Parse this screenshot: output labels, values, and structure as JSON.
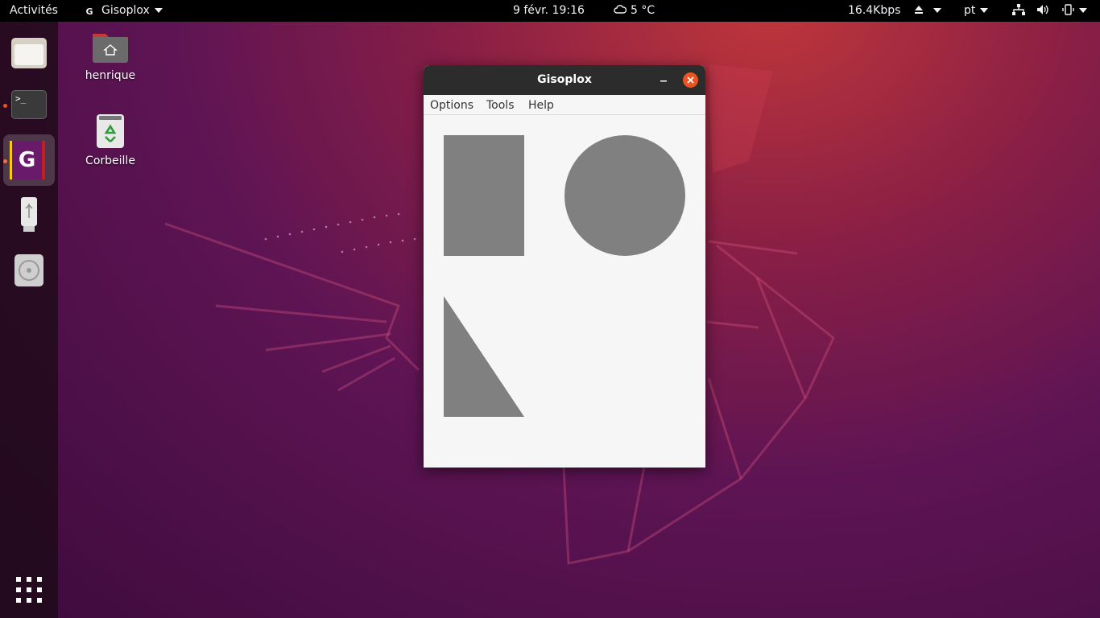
{
  "topbar": {
    "activities": "Activités",
    "app_name": "Gisoplox",
    "app_icon_glyph": "G",
    "datetime": "9 févr.  19:16",
    "weather": "5 °C",
    "network_speed": "16.4Kbps",
    "language": "pt"
  },
  "dock": {
    "items": [
      "files",
      "terminal",
      "gisoplox",
      "usb-drive",
      "disc"
    ],
    "terminal_glyph": ">_",
    "gisoplox_glyph": "G",
    "show_apps": "show-applications-grid"
  },
  "desktop": {
    "home_label": "henrique",
    "trash_label": "Corbeille"
  },
  "window": {
    "title": "Gisoplox",
    "menu": [
      "Options",
      "Tools",
      "Help"
    ],
    "shape_color": "#808080",
    "canvas_bg": "#f6f6f6"
  },
  "colors": {
    "accent": "#e95420",
    "topbar_bg": "#000000",
    "titlebar_bg": "#2c2c2c"
  }
}
